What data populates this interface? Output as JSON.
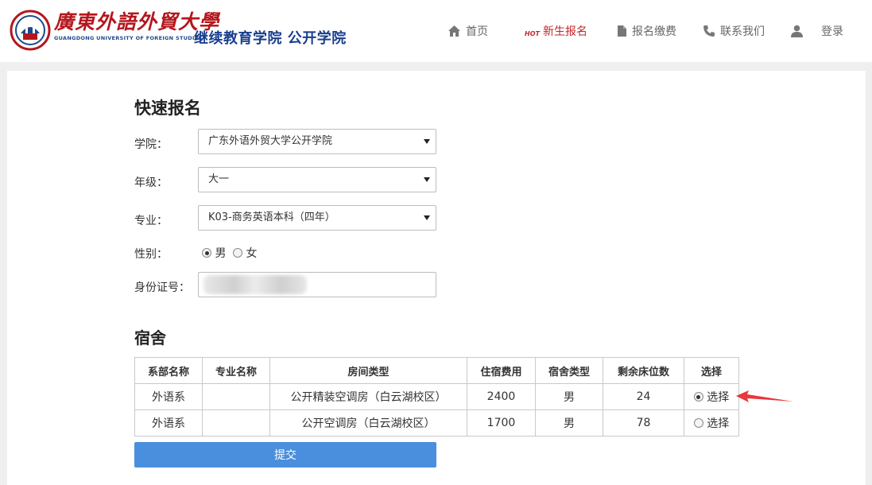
{
  "header": {
    "logo_cn": "廣東外語外貿大學",
    "logo_en": "GUANGDONG UNIVERSITY OF FOREIGN STUDIES",
    "college_name": "继续教育学院  公开学院",
    "nav": [
      {
        "label": "首页",
        "icon": "home-icon"
      },
      {
        "label": "新生报名",
        "icon": "hot-badge",
        "badge": "HOT",
        "active": true
      },
      {
        "label": "报名缴费",
        "icon": "document-icon"
      },
      {
        "label": "联系我们",
        "icon": "phone-icon"
      },
      {
        "label": "登录",
        "icon": "user-icon"
      }
    ],
    "brand_color": "#b5161d",
    "college_color": "#1a3f8f",
    "active_color": "#c1272d"
  },
  "form": {
    "title": "快速报名",
    "college_label": "学院：",
    "college_value": "广东外语外贸大学公开学院",
    "grade_label": "年级：",
    "grade_value": "大一",
    "major_label": "专业：",
    "major_value": "K03-商务英语本科（四年）",
    "gender_label": "性别：",
    "gender_options": [
      "男",
      "女"
    ],
    "gender_selected": "男",
    "id_label": "身份证号："
  },
  "dorm": {
    "title": "宿舍",
    "headers": [
      "系部名称",
      "专业名称",
      "房间类型",
      "住宿费用",
      "宿舍类型",
      "剩余床位数",
      "选择"
    ],
    "rows": [
      {
        "dept": "外语系",
        "major": "",
        "room": "公开精装空调房（白云湖校区）",
        "fee": "2400",
        "type": "男",
        "beds": "24",
        "select": "选择",
        "selected": true
      },
      {
        "dept": "外语系",
        "major": "",
        "room": "公开空调房（白云湖校区）",
        "fee": "1700",
        "type": "男",
        "beds": "78",
        "select": "选择",
        "selected": false
      }
    ]
  },
  "submit_label": "提交",
  "submit_color": "#4a8fdd",
  "annotation_arrow_color": "#e8383d"
}
